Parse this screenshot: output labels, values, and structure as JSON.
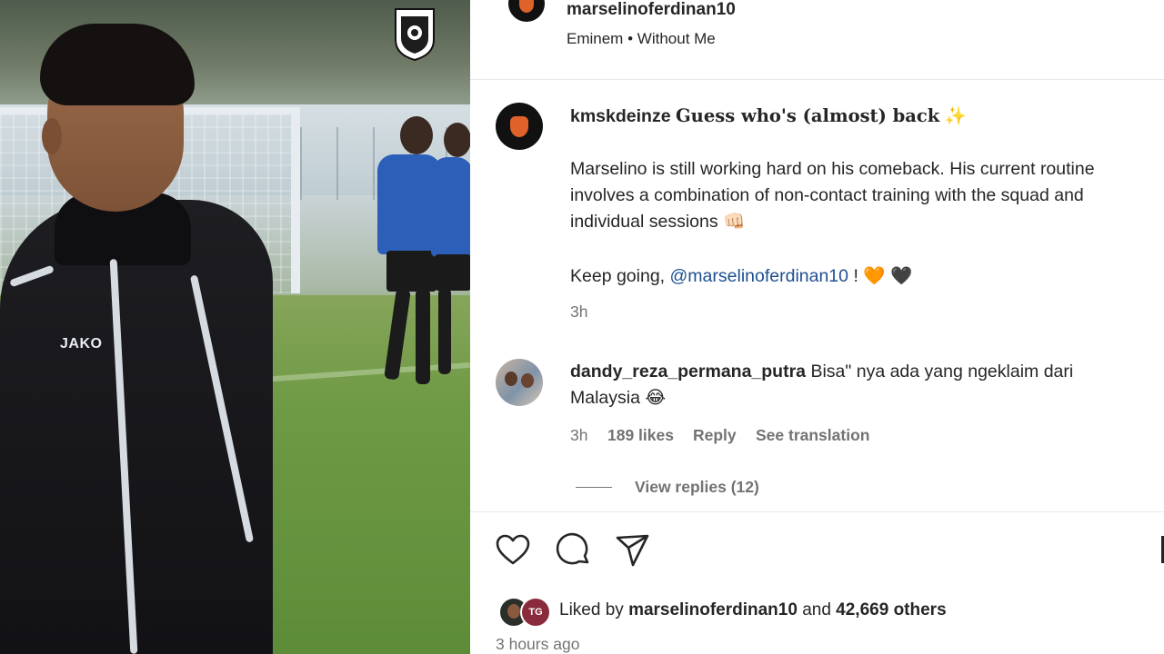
{
  "post": {
    "author": "marselinoferdinan10",
    "audio": {
      "artist": "Eminem",
      "separator": "•",
      "title": "Without Me"
    }
  },
  "media": {
    "jersey_brand": "JAKO"
  },
  "caption": {
    "username": "kmskdeinze",
    "headline": "Guess who's (almost) back",
    "headline_emoji": "✨",
    "paragraph1": "Marselino is still working hard on his comeback. His current routine involves a combination of non-contact training with the squad and individual sessions",
    "paragraph1_emoji": "👊🏻",
    "paragraph2_prefix": "Keep going,",
    "mention": "@marselinoferdinan10",
    "paragraph2_suffix": "!",
    "hearts": "🧡 🖤",
    "time": "3h"
  },
  "comment": {
    "username": "dandy_reza_permana_putra",
    "text_line1": "Bisa\" nya ada yang ngeklaim dari",
    "text_line2": "Malaysia",
    "emoji": "😂",
    "time": "3h",
    "likes": "189 likes",
    "reply": "Reply",
    "see_translation": "See translation",
    "view_replies": "View replies (12)"
  },
  "actions": {
    "like_icon": "heart-icon",
    "comment_icon": "comment-icon",
    "share_icon": "send-icon"
  },
  "likes": {
    "prefix": "Liked by",
    "user": "marselinoferdinan10",
    "and": "and",
    "others": "42,669 others",
    "second_avatar_initials": "TG"
  },
  "timestamp": "3 hours ago",
  "colors": {
    "text": "#262626",
    "secondary": "#737373",
    "mention": "#1d4f91",
    "heart_orange": "#f26522",
    "heart_black": "#000000"
  }
}
